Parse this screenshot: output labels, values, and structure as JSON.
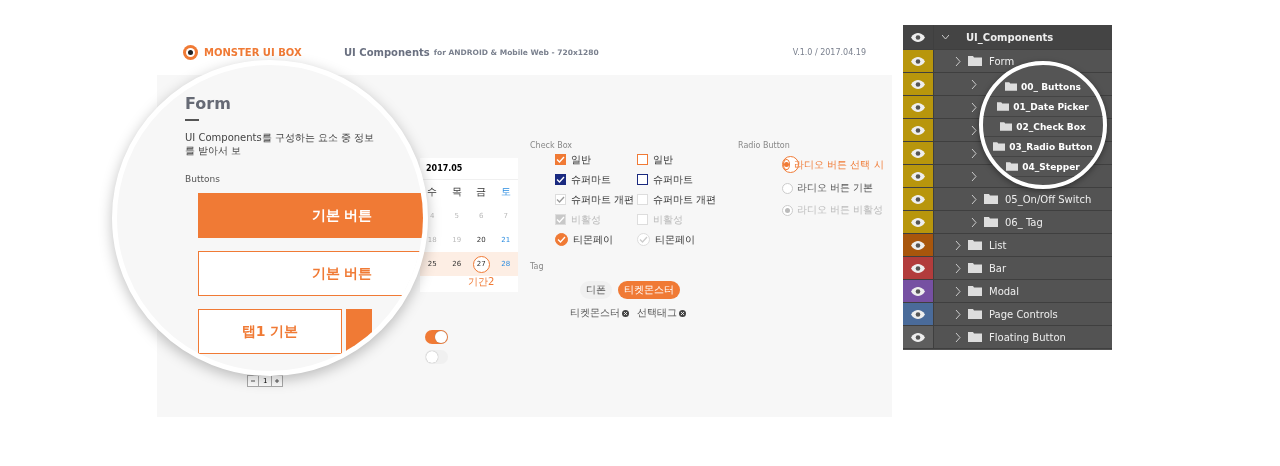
{
  "header": {
    "brand": "MONSTER UI BOX",
    "title": "UI Components",
    "subtitle": "for ANDROID & Mobile Web - 720x1280",
    "version": "V.1.0 / 2017.04.19"
  },
  "lens": {
    "heading": "Form",
    "description": "UI Components를 구성하는 요소 중 정보를 받아서 보",
    "section": "Buttons",
    "buttons": [
      {
        "label": "기본 버튼",
        "kind": "filled"
      },
      {
        "label": "기본 버튼",
        "kind": "outline"
      }
    ],
    "tabs": [
      {
        "label": "탭1 기본",
        "selected": false
      },
      {
        "selected": true
      }
    ]
  },
  "stepper": {
    "value": "1"
  },
  "calendar": {
    "title": "2017.05",
    "weekdays": [
      {
        "label": "수",
        "weekend": false
      },
      {
        "label": "목",
        "weekend": false
      },
      {
        "label": "금",
        "weekend": false
      },
      {
        "label": "토",
        "weekend": true
      }
    ],
    "weeks": [
      {
        "highlighted": false,
        "days": [
          {
            "label": "4",
            "muted": true,
            "selected": false
          },
          {
            "label": "5",
            "muted": true,
            "selected": false
          },
          {
            "label": "6",
            "muted": true,
            "selected": false
          },
          {
            "label": "7",
            "muted": true,
            "selected": false
          }
        ]
      },
      {
        "highlighted": false,
        "days": [
          {
            "label": "18",
            "muted": true,
            "selected": false
          },
          {
            "label": "19",
            "muted": true,
            "selected": false
          },
          {
            "label": "20",
            "muted": false,
            "weekend": false,
            "selected": false
          },
          {
            "label": "21",
            "muted": false,
            "weekend": true,
            "selected": false
          }
        ]
      },
      {
        "highlighted": true,
        "days": [
          {
            "label": "25",
            "muted": false,
            "weekend": false,
            "selected": false
          },
          {
            "label": "26",
            "muted": false,
            "weekend": false,
            "selected": false
          },
          {
            "label": "27",
            "muted": false,
            "weekend": false,
            "selected": true,
            "note": "기간2"
          },
          {
            "label": "28",
            "muted": false,
            "weekend": true,
            "selected": false
          }
        ]
      }
    ]
  },
  "toggles": [
    {
      "on": true
    },
    {
      "on": false
    }
  ],
  "checkbox_section": {
    "title": "Check Box",
    "columns": [
      [
        {
          "label": "일반",
          "kind": "orange",
          "checked": true
        },
        {
          "label": "슈퍼마트",
          "kind": "navy",
          "checked": true
        },
        {
          "label": "슈퍼마트 개편",
          "kind": "plain",
          "checked": true
        },
        {
          "label": "비활성",
          "kind": "disabled",
          "checked": true
        },
        {
          "label": "티몬페이",
          "kind": "round",
          "checked": true
        }
      ],
      [
        {
          "label": "일반",
          "kind": "orange",
          "checked": false
        },
        {
          "label": "슈퍼마트",
          "kind": "navy",
          "checked": false
        },
        {
          "label": "슈퍼마트 개편",
          "kind": "plain",
          "checked": false
        },
        {
          "label": "비활성",
          "kind": "disabled",
          "checked": false
        },
        {
          "label": "티몬페이",
          "kind": "round",
          "checked": false
        }
      ]
    ]
  },
  "radio_section": {
    "title": "Radio Button",
    "options": [
      {
        "label": "라디오 버튼 선택 시",
        "selected": true,
        "disabled": false
      },
      {
        "label": "라디오 버튼 기본",
        "selected": false,
        "disabled": false
      },
      {
        "label": "라디오 버튼 비활성",
        "selected": true,
        "disabled": true
      }
    ]
  },
  "tag_section": {
    "title": "Tag",
    "tags": [
      {
        "label": "디폰",
        "selected": false
      },
      {
        "label": "티켓몬스터",
        "selected": true
      }
    ],
    "removable": [
      {
        "label": "티켓몬스터"
      },
      {
        "label": "선택태그"
      }
    ]
  },
  "layers": {
    "name": "UI_Components",
    "expanded": true,
    "children": [
      {
        "name": "Form",
        "color": "#b8960c",
        "expanded": false,
        "children": [
          {
            "name": "00_ Buttons",
            "color": "#b8960c",
            "magnified": true
          },
          {
            "name": "01_Date Picker",
            "color": "#b8960c",
            "magnified": true
          },
          {
            "name": "02_Check Box",
            "color": "#b8960c",
            "magnified": true
          },
          {
            "name": "03_Radio Button",
            "color": "#b8960c",
            "magnified": true
          },
          {
            "name": "04_Stepper",
            "color": "#b8960c",
            "magnified": true
          },
          {
            "name": "05_On/Off Switch",
            "color": "#b8960c",
            "magnified": false
          },
          {
            "name": "06_ Tag",
            "color": "#b8960c",
            "magnified": false
          }
        ]
      },
      {
        "name": "List",
        "color": "#a8560c",
        "expanded": false
      },
      {
        "name": "Bar",
        "color": "#b23c3c",
        "expanded": false
      },
      {
        "name": "Modal",
        "color": "#7650a2",
        "expanded": false
      },
      {
        "name": "Page Controls",
        "color": "#4a6b9a",
        "expanded": false
      },
      {
        "name": "Floating Button",
        "color": "#5e5e5e",
        "expanded": false
      }
    ]
  }
}
